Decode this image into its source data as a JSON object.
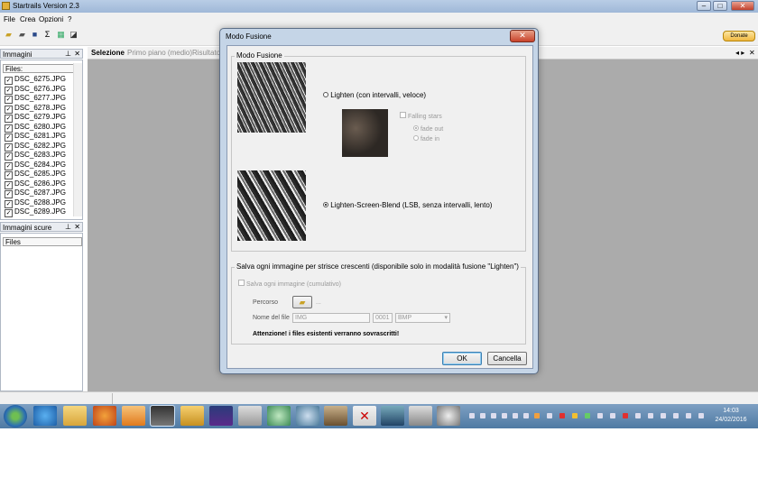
{
  "window": {
    "title": "Startrails Version 2.3"
  },
  "menu": {
    "items": [
      "File",
      "Crea",
      "Opzioni",
      "?"
    ]
  },
  "toolbar": {
    "donate_label": "Donate"
  },
  "panels": {
    "images": {
      "title": "Immagini",
      "files_header": "Files:",
      "files": [
        "DSC_6275.JPG",
        "DSC_6276.JPG",
        "DSC_6277.JPG",
        "DSC_6278.JPG",
        "DSC_6279.JPG",
        "DSC_6280.JPG",
        "DSC_6281.JPG",
        "DSC_6282.JPG",
        "DSC_6283.JPG",
        "DSC_6284.JPG",
        "DSC_6285.JPG",
        "DSC_6286.JPG",
        "DSC_6287.JPG",
        "DSC_6288.JPG",
        "DSC_6289.JPG"
      ]
    },
    "dark": {
      "title": "Immagini scure",
      "files_header": "Files"
    }
  },
  "tabs": [
    "Selezione",
    "Primo piano (medio)",
    "Risultato"
  ],
  "dialog": {
    "title": "Modo Fusione",
    "group_title": "Modo Fusione",
    "option_lighten": "Lighten (con intervalli, veloce)",
    "option_lighten_selected": false,
    "falling_stars": "Falling stars",
    "fade_out": "fade out",
    "fade_in": "fade in",
    "option_lsb": "Lighten-Screen-Blend (LSB, senza intervalli, lento)",
    "option_lsb_selected": true,
    "save_group_title": "Salva ogni immagine per strisce crescenti (disponibile solo in modalità fusione \"Lighten\")",
    "save_each": "Salva ogni immagine (cumulativo)",
    "path_label": "Percorso",
    "path_value": "...",
    "filename_label": "Nome del file",
    "filename_value": "IMG",
    "counter_value": "0001",
    "format_value": "BMP",
    "warning": "Attenzione! i files esistenti verranno sovrascritti!",
    "ok_label": "OK",
    "cancel_label": "Cancella"
  },
  "taskbar": {
    "time": "14:03",
    "date": "24/02/2016"
  }
}
